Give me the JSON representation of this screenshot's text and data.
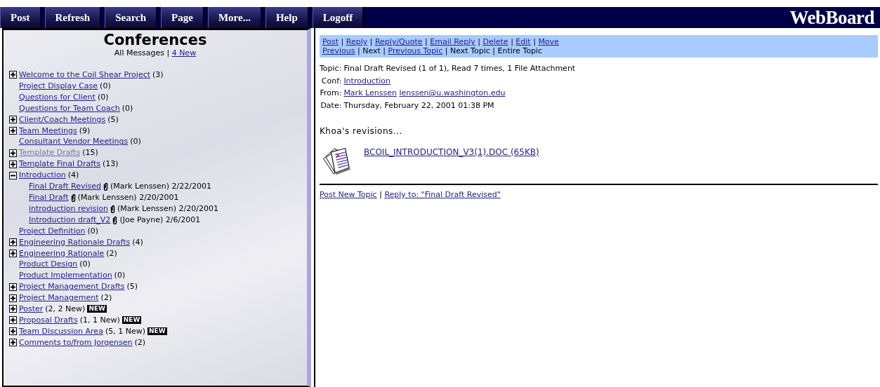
{
  "separator": "|",
  "toolbar": {
    "buttons": [
      "Post",
      "Refresh",
      "Search",
      "Page",
      "More...",
      "Help",
      "Logoff"
    ],
    "logo": "WebBoard"
  },
  "sidebar": {
    "title": "Conferences",
    "filters": [
      {
        "label": "All Messages",
        "link": false
      },
      {
        "label": "4 New",
        "link": true
      }
    ],
    "items": [
      {
        "label": "Welcome to the Coil Shear Project",
        "count": "(3)",
        "kind": "expandable",
        "expanded": false,
        "visited": false
      },
      {
        "label": "Project Display Case",
        "count": "(0)",
        "kind": "plain",
        "visited": false
      },
      {
        "label": "Questions for Client",
        "count": "(0)",
        "kind": "plain",
        "visited": false
      },
      {
        "label": "Questions for Team Coach",
        "count": "(0)",
        "kind": "plain",
        "visited": false
      },
      {
        "label": "Client/Coach Meetings",
        "count": "(5)",
        "kind": "expandable",
        "expanded": false,
        "visited": false
      },
      {
        "label": "Team Meetings",
        "count": "(9)",
        "kind": "expandable",
        "expanded": false,
        "visited": false
      },
      {
        "label": "Consultant Vendor Meetings",
        "count": "(0)",
        "kind": "plain",
        "visited": false
      },
      {
        "label": "Template Drafts",
        "count": "(15)",
        "kind": "expandable",
        "expanded": false,
        "visited": true
      },
      {
        "label": "Template Final Drafts",
        "count": "(13)",
        "kind": "expandable",
        "expanded": false,
        "visited": false
      },
      {
        "label": "Introduction",
        "count": "(4)",
        "kind": "expandable",
        "expanded": true,
        "visited": false,
        "children": [
          {
            "title": "Final Draft Revised",
            "attachment": true,
            "byline": "(Mark Lenssen) 2/22/2001"
          },
          {
            "title": "Final Draft",
            "attachment": true,
            "byline": "(Mark Lenssen) 2/20/2001"
          },
          {
            "title": "introduction revision",
            "attachment": true,
            "byline": "(Mark Lenssen) 2/20/2001"
          },
          {
            "title": "Introduction draft_V2",
            "attachment": true,
            "byline": "(Joe Payne) 2/6/2001"
          }
        ]
      },
      {
        "label": "Project Definition",
        "count": "(0)",
        "kind": "plain",
        "visited": false
      },
      {
        "label": "Engineering Rationale Drafts",
        "count": "(4)",
        "kind": "expandable",
        "expanded": false,
        "visited": false
      },
      {
        "label": "Engineering Rationale",
        "count": "(2)",
        "kind": "expandable",
        "expanded": false,
        "visited": false
      },
      {
        "label": "Product Design",
        "count": "(0)",
        "kind": "plain",
        "visited": false
      },
      {
        "label": "Product Implementation",
        "count": "(0)",
        "kind": "plain",
        "visited": false
      },
      {
        "label": "Project Management Drafts",
        "count": "(5)",
        "kind": "expandable",
        "expanded": false,
        "visited": false
      },
      {
        "label": "Project Management",
        "count": "(2)",
        "kind": "expandable",
        "expanded": false,
        "visited": false
      },
      {
        "label": "Poster",
        "count": "(2, 2 New)",
        "badge": "NEW",
        "kind": "expandable",
        "expanded": false,
        "visited": false
      },
      {
        "label": "Proposal Drafts",
        "count": "(1, 1 New)",
        "badge": "NEW",
        "kind": "expandable",
        "expanded": false,
        "visited": false
      },
      {
        "label": "Team Discussion Area",
        "count": "(5, 1 New)",
        "badge": "NEW",
        "kind": "expandable",
        "expanded": false,
        "visited": false
      },
      {
        "label": "Comments to/from Jorgensen",
        "count": "(2)",
        "kind": "expandable",
        "expanded": false,
        "visited": false
      }
    ]
  },
  "message": {
    "actions": [
      [
        {
          "label": "Post",
          "link": true
        },
        {
          "label": "Reply",
          "link": true
        },
        {
          "label": "Reply/Quote",
          "link": true
        },
        {
          "label": "Email Reply",
          "link": true
        },
        {
          "label": "Delete",
          "link": true
        },
        {
          "label": "Edit",
          "link": true
        },
        {
          "label": "Move",
          "link": true
        }
      ],
      [
        {
          "label": "Previous",
          "link": true
        },
        {
          "label": "Next",
          "link": false
        },
        {
          "label": "Previous Topic",
          "link": true
        },
        {
          "label": "Next Topic",
          "link": false
        },
        {
          "label": "Entire Topic",
          "link": false
        }
      ]
    ],
    "headers": [
      {
        "label": "Topic:",
        "values": [
          {
            "text": "Final Draft Revised (1 of 1), Read 7 times, 1 File Attachment",
            "link": false
          }
        ]
      },
      {
        "label": "Conf:",
        "values": [
          {
            "text": "Introduction",
            "link": true
          }
        ]
      },
      {
        "label": "From:",
        "values": [
          {
            "text": "Mark Lenssen",
            "link": true
          },
          {
            "text": "lenssen@u.washington.edu",
            "link": true
          }
        ]
      },
      {
        "label": "Date:",
        "values": [
          {
            "text": "Thursday, February 22, 2001 01:38 PM",
            "link": false
          }
        ]
      }
    ],
    "body": "Khoa's revisions...",
    "attachment": "BCOIL_INTRODUCTION_V3(1).DOC (65KB)",
    "footer_links": [
      "Post New Topic",
      "Reply to: \"Final Draft Revised\""
    ]
  }
}
